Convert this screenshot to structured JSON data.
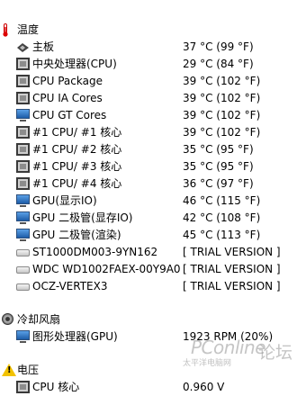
{
  "top_partial": {
    "label": "",
    "value": ""
  },
  "sections": {
    "temperature": {
      "title": "温度",
      "icon": "thermometer-icon",
      "items": [
        {
          "label": "主板",
          "value": "37 °C  (99 °F)",
          "icon": "motherboard-icon"
        },
        {
          "label": "中央处理器(CPU)",
          "value": "29 °C  (84 °F)",
          "icon": "cpu-chip-icon"
        },
        {
          "label": "CPU Package",
          "value": "39 °C  (102 °F)",
          "icon": "cpu-chip-icon"
        },
        {
          "label": "CPU IA Cores",
          "value": "39 °C  (102 °F)",
          "icon": "cpu-chip-icon"
        },
        {
          "label": "CPU GT Cores",
          "value": "39 °C  (102 °F)",
          "icon": "monitor-icon"
        },
        {
          "label": "#1 CPU/ #1 核心",
          "value": "39 °C  (102 °F)",
          "icon": "cpu-chip-icon"
        },
        {
          "label": "#1 CPU/ #2 核心",
          "value": "35 °C  (95 °F)",
          "icon": "cpu-chip-icon"
        },
        {
          "label": "#1 CPU/ #3 核心",
          "value": "35 °C  (95 °F)",
          "icon": "cpu-chip-icon"
        },
        {
          "label": "#1 CPU/ #4 核心",
          "value": "36 °C  (97 °F)",
          "icon": "cpu-chip-icon"
        },
        {
          "label": "GPU(显示IO)",
          "value": "46 °C  (115 °F)",
          "icon": "monitor-icon"
        },
        {
          "label": "GPU 二极管(显存IO)",
          "value": "42 °C  (108 °F)",
          "icon": "monitor-icon"
        },
        {
          "label": "GPU 二极管(渲染)",
          "value": "45 °C  (113 °F)",
          "icon": "monitor-icon"
        },
        {
          "label": "ST1000DM003-9YN162",
          "value": "[ TRIAL VERSION ]",
          "icon": "hard-drive-icon"
        },
        {
          "label": "WDC WD1002FAEX-00Y9A0",
          "value": "[ TRIAL VERSION ]",
          "icon": "hard-drive-icon"
        },
        {
          "label": "OCZ-VERTEX3",
          "value": "[ TRIAL VERSION ]",
          "icon": "hard-drive-icon"
        }
      ]
    },
    "fans": {
      "title": "冷却风扇",
      "icon": "fan-icon",
      "items": [
        {
          "label": "图形处理器(GPU)",
          "value": "1923 RPM  (20%)",
          "icon": "monitor-icon"
        }
      ]
    },
    "voltage": {
      "title": "电压",
      "icon": "warning-icon",
      "items": [
        {
          "label": "CPU 核心",
          "value": "0.960 V",
          "icon": "cpu-chip-icon"
        }
      ]
    }
  },
  "watermark": {
    "brand": "PConline",
    "sub": "太平洋电脑网",
    "forum": "论坛"
  }
}
